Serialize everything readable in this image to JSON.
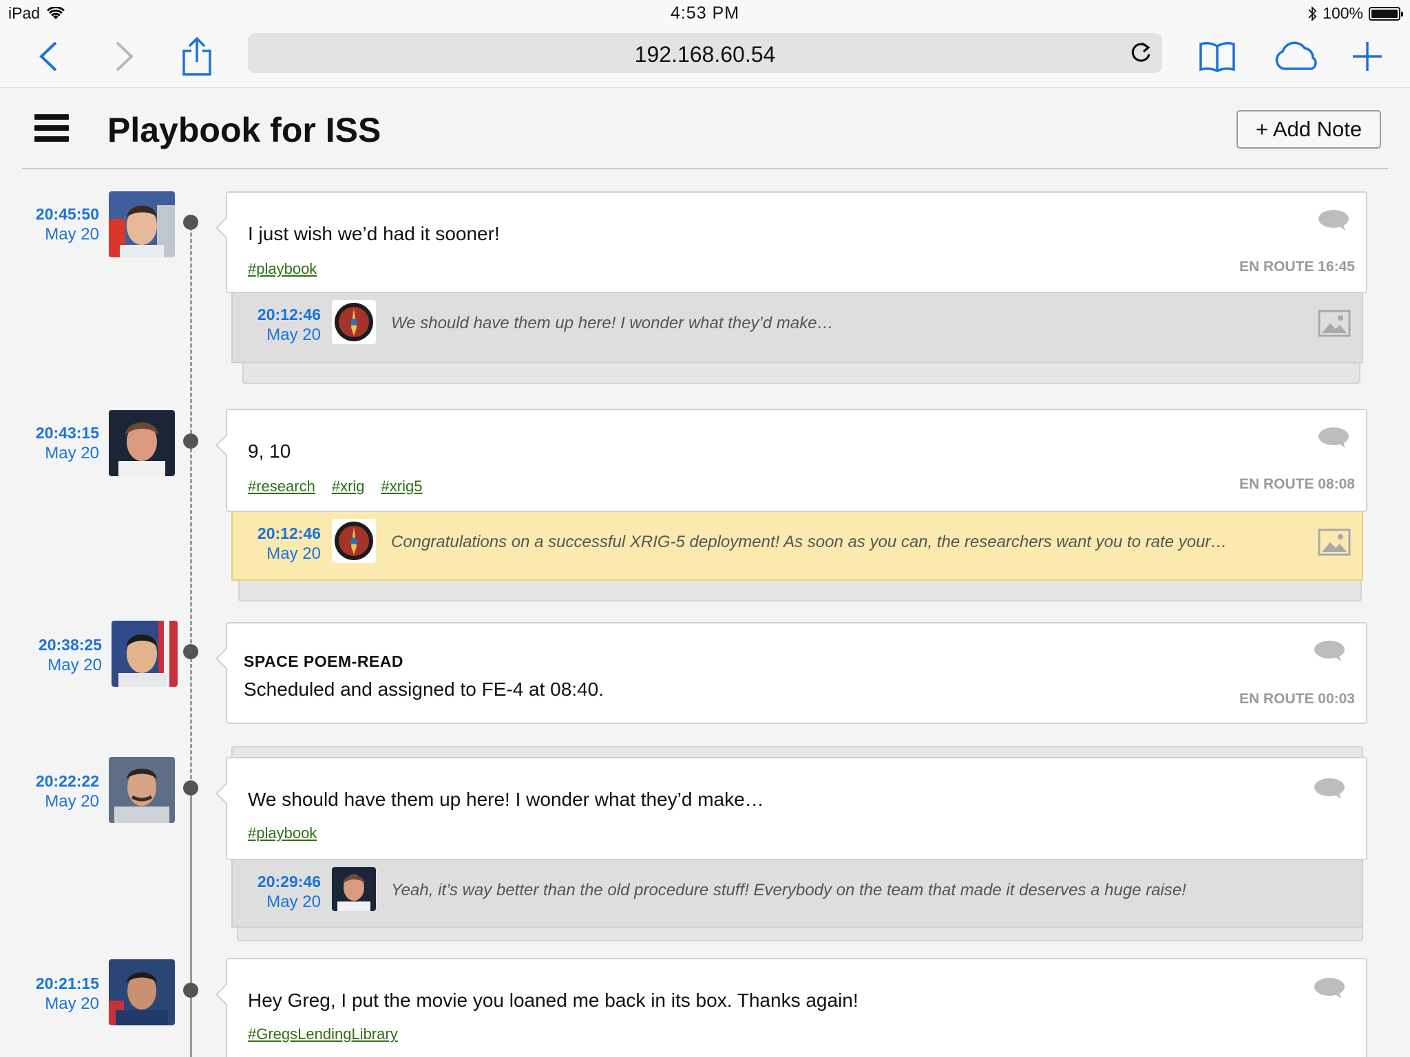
{
  "status_bar": {
    "device": "iPad",
    "time": "4:53 PM",
    "battery": "100%",
    "battery_level": 1.0
  },
  "browser": {
    "url": "192.168.60.54",
    "icons": [
      "back-icon",
      "forward-icon",
      "share-icon",
      "reload-icon",
      "bookmarks-icon",
      "icloud-tabs-icon",
      "new-tab-icon"
    ]
  },
  "app": {
    "title": "Playbook for ISS",
    "add_note_label": "+ Add Note"
  },
  "entries": [
    {
      "time": "20:45:50",
      "date": "May 20",
      "message": "I just wish we’d had it sooner!",
      "tags": [
        "#playbook"
      ],
      "status": "EN ROUTE 16:45",
      "reply": {
        "time": "20:12:46",
        "date": "May 20",
        "text": "We should have them up here! I wonder what they’d make…",
        "highlight": false
      }
    },
    {
      "time": "20:43:15",
      "date": "May 20",
      "message": "9, 10",
      "tags": [
        "#research",
        "#xrig",
        "#xrig5"
      ],
      "status": "EN ROUTE 08:08",
      "reply": {
        "time": "20:12:46",
        "date": "May 20",
        "text": "Congratulations on a successful XRIG-5 deployment! As soon as you can, the researchers want you to rate your…",
        "highlight": true
      }
    },
    {
      "time": "20:38:25",
      "date": "May 20",
      "title": "SPACE POEM-READ",
      "message": "Scheduled and assigned to FE-4 at 08:40.",
      "status": "EN ROUTE 00:03"
    },
    {
      "time": "20:22:22",
      "date": "May 20",
      "message": "We should have them up here! I wonder what they’d make…",
      "tags": [
        "#playbook"
      ],
      "reply": {
        "time": "20:29:46",
        "date": "May 20",
        "text": "Yeah, it’s way better than the old procedure stuff! Everybody on the team that made it deserves a huge raise!",
        "highlight": false
      }
    },
    {
      "time": "20:21:15",
      "date": "May 20",
      "message": "Hey Greg, I put the movie you loaned me back in its box. Thanks again!",
      "tags": [
        "#GregsLendingLibrary"
      ]
    }
  ],
  "colors": {
    "timestamp_blue": "#1a73d9",
    "tag_green": "#2f6f12",
    "highlight_yellow": "#fbe9b0",
    "reply_gray": "#dedede"
  }
}
